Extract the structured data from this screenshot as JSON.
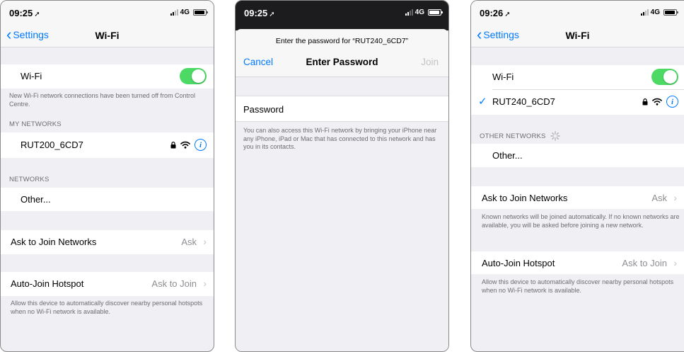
{
  "colors": {
    "accent": "#007aff",
    "toggle_on": "#4cd964",
    "secondary_text": "#6d6d72",
    "background": "#efeff4"
  },
  "phone1": {
    "status": {
      "time": "09:25",
      "network": "4G"
    },
    "nav": {
      "back_label": "Settings",
      "title": "Wi-Fi"
    },
    "wifi_label": "Wi-Fi",
    "wifi_toggle_on": true,
    "wifi_note": "New Wi-Fi network connections have been turned off from Control Centre.",
    "my_networks_header": "MY NETWORKS",
    "my_network_name": "RUT200_6CD7",
    "networks_header": "NETWORKS",
    "other_label": "Other...",
    "ask_join": {
      "label": "Ask to Join Networks",
      "value": "Ask"
    },
    "auto_join": {
      "label": "Auto-Join Hotspot",
      "value": "Ask to Join"
    },
    "auto_join_note": "Allow this device to automatically discover nearby personal hotspots when no Wi-Fi network is available."
  },
  "phone2": {
    "status": {
      "time": "09:25",
      "network": "4G"
    },
    "prompt": "Enter the password for “RUT240_6CD7”",
    "cancel_label": "Cancel",
    "title": "Enter Password",
    "join_label": "Join",
    "password_label": "Password",
    "password_note": "You can also access this Wi-Fi network by bringing your iPhone near any iPhone, iPad or Mac that has connected to this network and has you in its contacts."
  },
  "phone3": {
    "status": {
      "time": "09:26",
      "network": "4G"
    },
    "nav": {
      "back_label": "Settings",
      "title": "Wi-Fi"
    },
    "wifi_label": "Wi-Fi",
    "wifi_toggle_on": true,
    "connected_network": "RUT240_6CD7",
    "other_networks_header": "OTHER NETWORKS",
    "other_label": "Other...",
    "ask_join": {
      "label": "Ask to Join Networks",
      "value": "Ask"
    },
    "ask_join_note": "Known networks will be joined automatically. If no known networks are available, you will be asked before joining a new network.",
    "auto_join": {
      "label": "Auto-Join Hotspot",
      "value": "Ask to Join"
    },
    "auto_join_note": "Allow this device to automatically discover nearby personal hotspots when no Wi-Fi network is available."
  }
}
